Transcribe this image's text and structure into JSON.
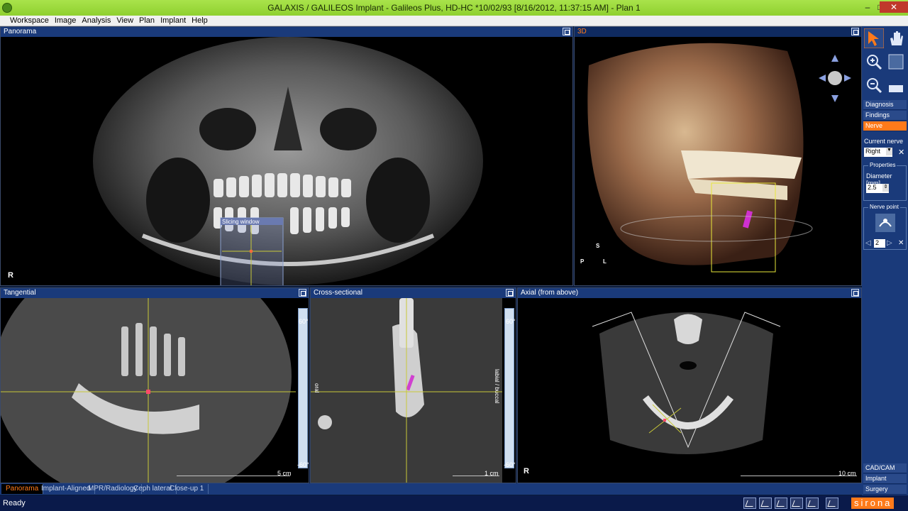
{
  "window": {
    "title": "GALAXIS / GALILEOS Implant - Galileos Plus, HD-HC *10/02/93 [8/16/2012, 11:37:15 AM] - Plan 1"
  },
  "menu": [
    "Workspace",
    "Image",
    "Analysis",
    "View",
    "Plan",
    "Implant",
    "Help"
  ],
  "panels": {
    "panorama": {
      "title": "Panorama",
      "marker": "R",
      "slicing_label": "Slicing window"
    },
    "view3d": {
      "title": "3D",
      "marker_s": "S",
      "marker_p": "P",
      "marker_l": "L"
    },
    "tangential": {
      "title": "Tangential",
      "scale": "5 cm",
      "angle_top": "60°",
      "angle_bottom": "-60°"
    },
    "cross": {
      "title": "Cross-sectional",
      "scale": "1 cm",
      "angle_top": "60°",
      "angle_bottom": "-60°",
      "side_label": "labial / buccal",
      "left_label": "oral"
    },
    "axial": {
      "title": "Axial (from above)",
      "marker": "R",
      "scale": "10 cm"
    }
  },
  "tabs": [
    "Panorama",
    "Implant-Aligned",
    "MPR/Radiology",
    "Ceph lateral",
    "Close-up 1"
  ],
  "active_tab": "Panorama",
  "status": {
    "text": "Ready",
    "brand": "sirona"
  },
  "rightbar": {
    "modes": [
      "Diagnosis",
      "Findings",
      "Nerve"
    ],
    "active_mode": "Nerve",
    "current_nerve_label": "Current nerve",
    "current_nerve_value": "Right",
    "properties_label": "Properties",
    "diameter_label": "Diameter [mm]",
    "diameter_value": "2.5",
    "nerve_point_label": "Nerve point",
    "nerve_point_value": "2",
    "bottom_items": [
      "CAD/CAM",
      "Implant",
      "Surgery"
    ]
  },
  "colors": {
    "accent": "#ff7a1a",
    "header": "#1a3a7a",
    "titlebar": "#a9e34b"
  }
}
